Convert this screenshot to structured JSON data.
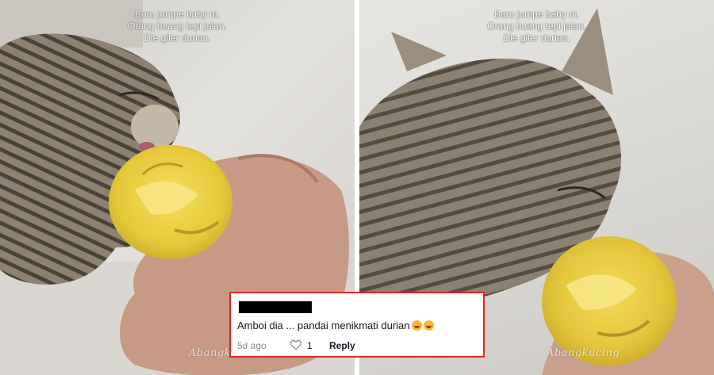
{
  "caption": {
    "line1": "Baru jumpe baby ni.",
    "line2": "Orang buang tepi jalan.",
    "line3": "Die giler durian."
  },
  "watermark": "Abangkucing",
  "comment": {
    "text": "Amboi dia ... pandai menikmati durian",
    "emoji_icons": [
      "rolling-on-floor-laughing-icon",
      "rolling-on-floor-laughing-icon"
    ],
    "time": "5d ago",
    "likes": "1",
    "reply_label": "Reply",
    "heart_icon": "heart-outline-icon",
    "highlight_color": "#e5262b"
  }
}
